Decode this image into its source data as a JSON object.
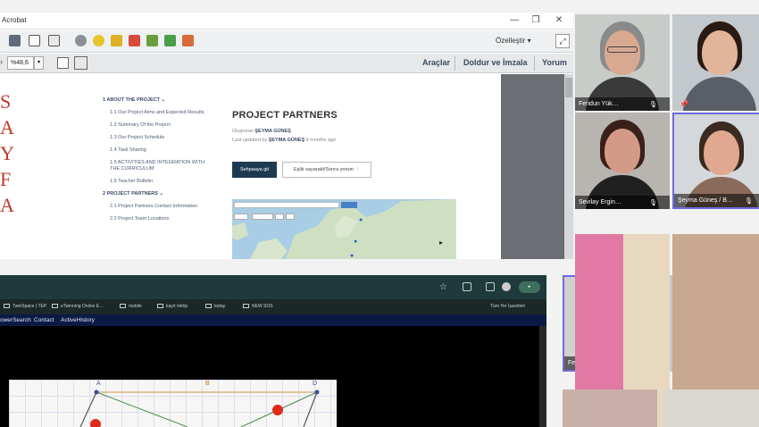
{
  "acrobat": {
    "title": "Acrobat",
    "customize": "Özelleştir",
    "zoom": "%48,6",
    "tools": [
      "Araçlar",
      "Doldur ve İmzala",
      "Yorum"
    ],
    "side_letters": [
      "S",
      "A",
      "Y",
      "F",
      "A"
    ],
    "toc": [
      {
        "label": "1  ABOUT THE PROJECT  ⌄",
        "main": true
      },
      {
        "label": "1.1  Our Project Aims and Expected Results",
        "main": false
      },
      {
        "label": "1.2  Summary Of the Project",
        "main": false
      },
      {
        "label": "1.3  Our Project Schedule",
        "main": false
      },
      {
        "label": "1.4  Task Sharing",
        "main": false
      },
      {
        "label": "1.5  ACTIVITIES AND INTEGRATION WITH THE CURRICULUM",
        "main": false
      },
      {
        "label": "1.6  Teacher Bulletin",
        "main": false
      },
      {
        "label": "2  PROJECT PARTNERS  ⌄",
        "main": true
      },
      {
        "label": "2.1  Project Partners Contact Information",
        "main": false
      },
      {
        "label": "2.2  Project Team Locations",
        "main": false
      }
    ],
    "section_title": "PROJECT PARTNERS",
    "owner_label": "Oluşturan",
    "owner_name": "ŞEYMA GÜNEŞ",
    "updated_label": "Last updated by",
    "updated_name": "ŞEYMA GÜNEŞ",
    "updated_time": "9 months ago",
    "btn_primary": "Sehpaaya git",
    "btn_secondary": "Eşlik sayarakt/Sonra yorum"
  },
  "browser": {
    "bookmarks": [
      "TwinSpace | TEP",
      "eTwinning Online E…",
      "mobile",
      "kayıt mitöp",
      "today",
      "NEW SOS"
    ],
    "bookmarks_right": "Tüm Yer İşaretleri",
    "nav_links": [
      "owerSearch",
      "Contact",
      "ActiveHistory"
    ],
    "canvas_labels": [
      "A",
      "B",
      "D"
    ]
  },
  "participants": [
    {
      "name": "Feridun Yük…",
      "selected": false
    },
    {
      "name": "",
      "selected": false
    },
    {
      "name": "Sevilay Ergin…",
      "selected": false
    },
    {
      "name": "Şeyma Güneş / B…",
      "selected": true
    },
    {
      "name": "Feridun Yüksel / …",
      "selected": true
    },
    {
      "name": "",
      "selected": false
    }
  ],
  "colors": {
    "accent": "#6d6adf",
    "navy": "#1e3a52",
    "danger": "#c0392b"
  }
}
